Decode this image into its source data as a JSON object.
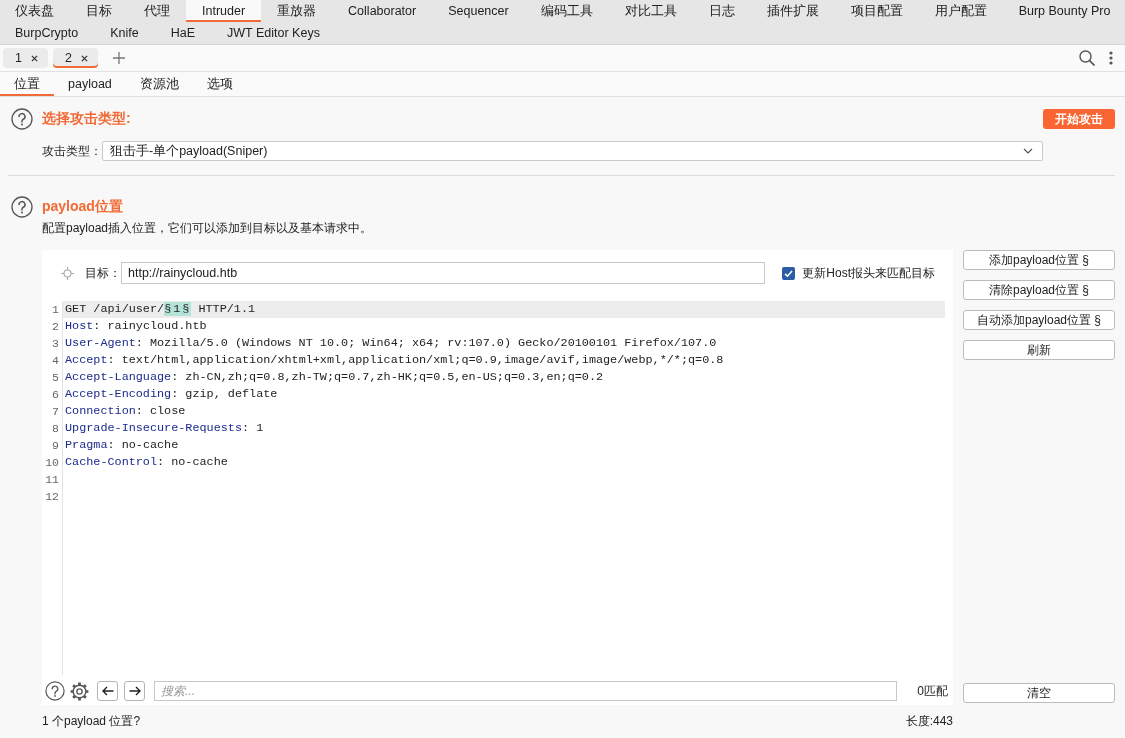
{
  "tool_tab_rows": [
    {
      "tabs": [
        {
          "label": "仪表盘",
          "selected": false
        },
        {
          "label": "目标",
          "selected": false
        },
        {
          "label": "代理",
          "selected": false
        },
        {
          "label": "Intruder",
          "selected": true
        },
        {
          "label": "重放器",
          "selected": false
        },
        {
          "label": "Collaborator",
          "selected": false
        },
        {
          "label": "Sequencer",
          "selected": false
        },
        {
          "label": "编码工具",
          "selected": false
        },
        {
          "label": "对比工具",
          "selected": false
        },
        {
          "label": "日志",
          "selected": false
        },
        {
          "label": "插件扩展",
          "selected": false
        },
        {
          "label": "项目配置",
          "selected": false
        },
        {
          "label": "用户配置",
          "selected": false
        },
        {
          "label": "Burp Bounty Pro",
          "selected": false
        }
      ]
    },
    {
      "tabs": [
        {
          "label": "BurpCrypto",
          "selected": false
        },
        {
          "label": "Knife",
          "selected": false
        },
        {
          "label": "HaE",
          "selected": false
        },
        {
          "label": "JWT Editor Keys",
          "selected": false
        }
      ]
    }
  ],
  "request_tabs": [
    {
      "label": "1",
      "selected": false
    },
    {
      "label": "2",
      "selected": true
    }
  ],
  "sub_tabs": [
    {
      "label": "位置",
      "selected": true
    },
    {
      "label": "payload",
      "selected": false
    },
    {
      "label": "资源池",
      "selected": false
    },
    {
      "label": "选项",
      "selected": false
    }
  ],
  "attack_type_section": {
    "title": "选择攻击类型:",
    "start_button": "开始攻击",
    "field_label": "攻击类型：",
    "value": "狙击手-单个payload(Sniper)"
  },
  "positions_section": {
    "title": "payload位置",
    "description": "配置payload插入位置，它们可以添加到目标以及基本请求中。",
    "target": {
      "label": "目标：",
      "value": "http://rainycloud.htb"
    },
    "update_host": {
      "label": "更新Host报头来匹配目标",
      "checked": true
    },
    "side_buttons": [
      "添加payload位置 §",
      "清除payload位置 §",
      "自动添加payload位置 §",
      "刷新"
    ],
    "request_lines": [
      {
        "number": "1",
        "current": true,
        "segments": [
          {
            "kind": "plain",
            "text": "GET /api/user/"
          },
          {
            "kind": "marker",
            "text": "§1§"
          },
          {
            "kind": "plain",
            "text": " HTTP/1.1"
          }
        ]
      },
      {
        "number": "2",
        "current": false,
        "segments": [
          {
            "kind": "header_name",
            "text": "Host"
          },
          {
            "kind": "plain",
            "text": ": rainycloud.htb"
          }
        ]
      },
      {
        "number": "3",
        "current": false,
        "segments": [
          {
            "kind": "header_name",
            "text": "User-Agent"
          },
          {
            "kind": "plain",
            "text": ": Mozilla/5.0 (Windows NT 10.0; Win64; x64; rv:107.0) Gecko/20100101 Firefox/107.0"
          }
        ]
      },
      {
        "number": "4",
        "current": false,
        "segments": [
          {
            "kind": "header_name",
            "text": "Accept"
          },
          {
            "kind": "plain",
            "text": ": text/html,application/xhtml+xml,application/xml;q=0.9,image/avif,image/webp,*/*;q=0.8"
          }
        ]
      },
      {
        "number": "5",
        "current": false,
        "segments": [
          {
            "kind": "header_name",
            "text": "Accept-Language"
          },
          {
            "kind": "plain",
            "text": ": zh-CN,zh;q=0.8,zh-TW;q=0.7,zh-HK;q=0.5,en-US;q=0.3,en;q=0.2"
          }
        ]
      },
      {
        "number": "6",
        "current": false,
        "segments": [
          {
            "kind": "header_name",
            "text": "Accept-Encoding"
          },
          {
            "kind": "plain",
            "text": ": gzip, deflate"
          }
        ]
      },
      {
        "number": "7",
        "current": false,
        "segments": [
          {
            "kind": "header_name",
            "text": "Connection"
          },
          {
            "kind": "plain",
            "text": ": close"
          }
        ]
      },
      {
        "number": "8",
        "current": false,
        "segments": [
          {
            "kind": "header_name",
            "text": "Upgrade-Insecure-Requests"
          },
          {
            "kind": "plain",
            "text": ": 1"
          }
        ]
      },
      {
        "number": "9",
        "current": false,
        "segments": [
          {
            "kind": "header_name",
            "text": "Pragma"
          },
          {
            "kind": "plain",
            "text": ": no-cache"
          }
        ]
      },
      {
        "number": "10",
        "current": false,
        "segments": [
          {
            "kind": "header_name",
            "text": "Cache-Control"
          },
          {
            "kind": "plain",
            "text": ": no-cache"
          }
        ]
      },
      {
        "number": "11",
        "current": false
      },
      {
        "number": "12",
        "current": false
      }
    ],
    "search": {
      "placeholder": "搜索...",
      "matches": "0匹配"
    },
    "clear_button": "清空"
  },
  "status_bar": {
    "positions_count": "1 个payload 位置?",
    "length": "长度:443"
  }
}
